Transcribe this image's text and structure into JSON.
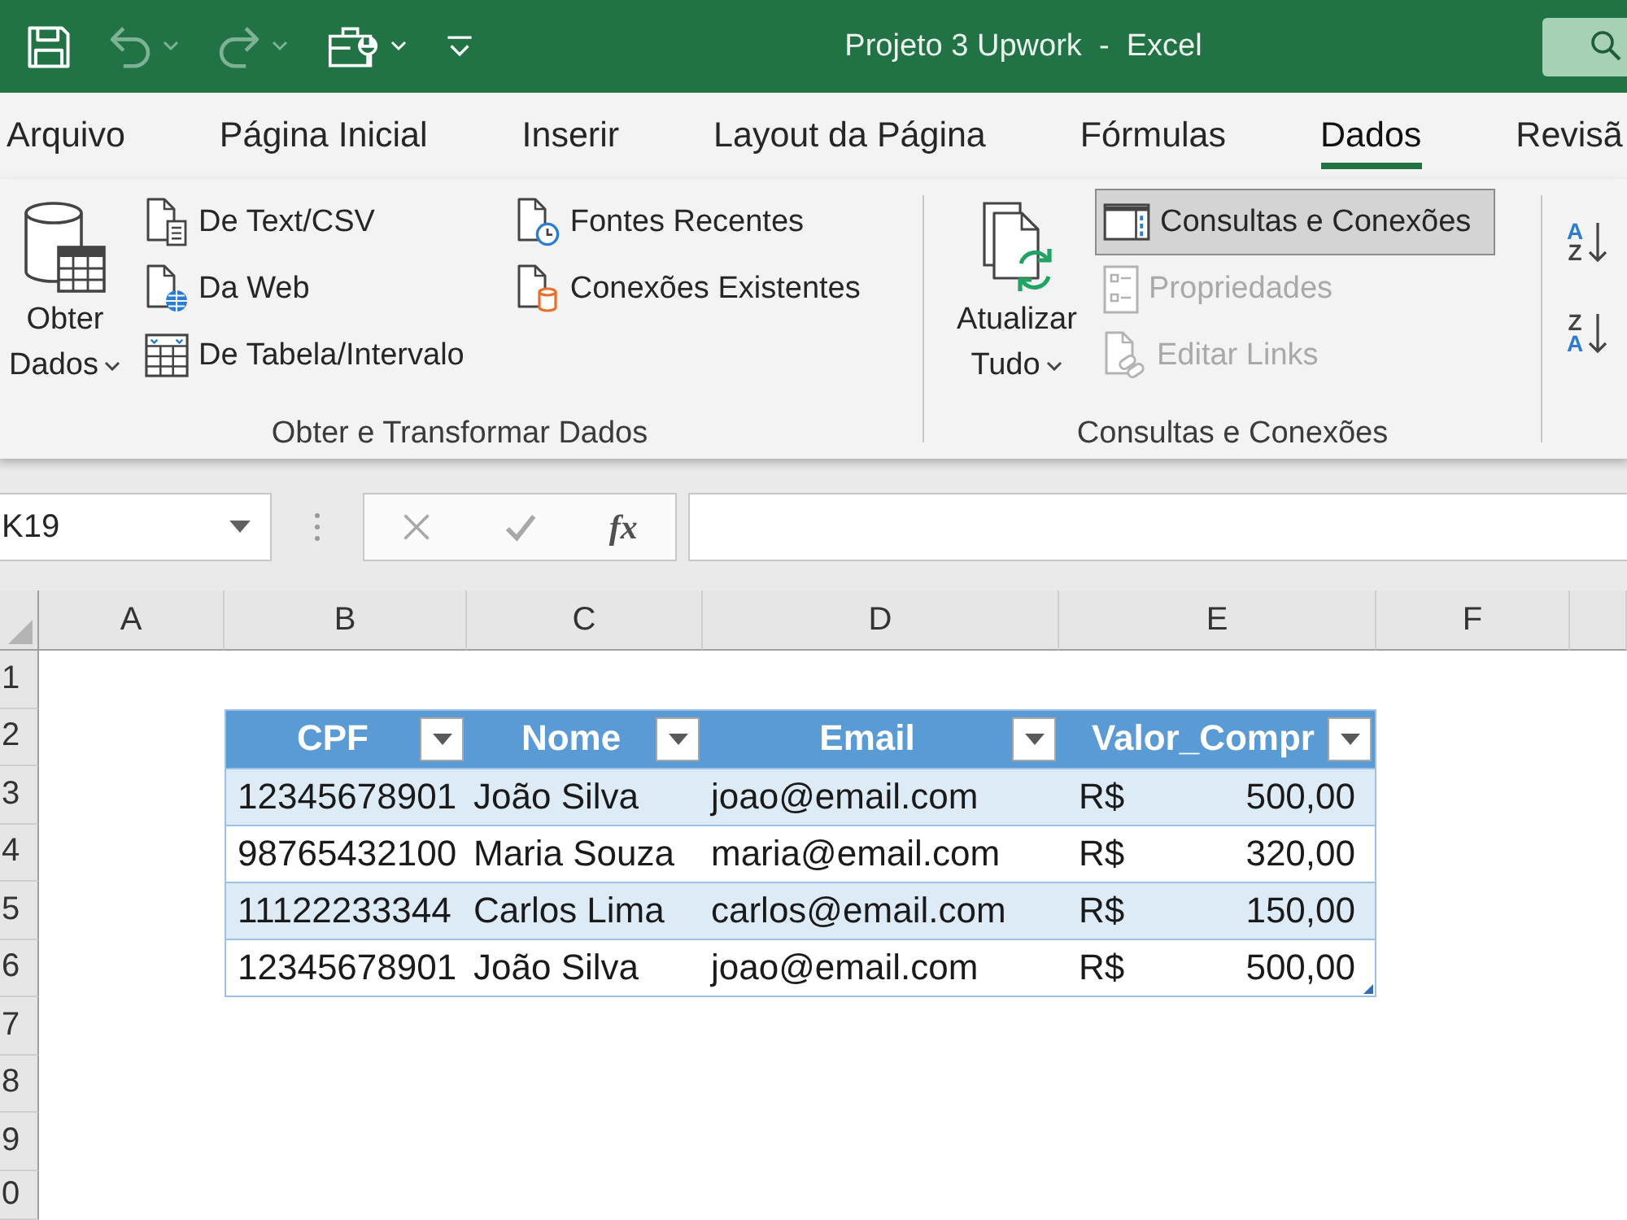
{
  "window": {
    "title": "Projeto 3 Upwork  -  Excel"
  },
  "quick_access": [
    {
      "kind": "save",
      "disabled": false,
      "menu": false
    },
    {
      "kind": "undo",
      "disabled": true,
      "menu": true
    },
    {
      "kind": "redo",
      "disabled": true,
      "menu": true
    },
    {
      "kind": "touch_mode",
      "disabled": false,
      "menu": true
    },
    {
      "kind": "customize",
      "disabled": false,
      "menu": false
    }
  ],
  "ribbon_tabs": [
    {
      "label": "Arquivo",
      "selected": false
    },
    {
      "label": "Página Inicial",
      "selected": false
    },
    {
      "label": "Inserir",
      "selected": false
    },
    {
      "label": "Layout da Página",
      "selected": false
    },
    {
      "label": "Fórmulas",
      "selected": false
    },
    {
      "label": "Dados",
      "selected": true
    },
    {
      "label": "Revisã",
      "selected": false
    }
  ],
  "ribbon_groups": [
    {
      "label": "Obter e Transformar Dados",
      "large_buttons": [
        {
          "label": "Obter Dados",
          "kind": "database",
          "menu": true
        }
      ],
      "columns": [
        [
          {
            "label": "De Text/CSV",
            "kind": "text_file",
            "pressed": false,
            "disabled": false
          },
          {
            "label": "Da Web",
            "kind": "web",
            "pressed": false,
            "disabled": false
          },
          {
            "label": "De Tabela/Intervalo",
            "kind": "table",
            "pressed": false,
            "disabled": false
          }
        ],
        [
          {
            "label": "Fontes Recentes",
            "kind": "recent",
            "pressed": false,
            "disabled": false
          },
          {
            "label": "Conexões Existentes",
            "kind": "connections",
            "pressed": false,
            "disabled": false
          }
        ]
      ]
    },
    {
      "label": "Consultas e Conexões",
      "large_buttons": [
        {
          "label": "Atualizar Tudo",
          "kind": "refresh",
          "menu": true
        }
      ],
      "columns": [
        [
          {
            "label": "Consultas e Conexões",
            "kind": "queries_pane",
            "pressed": true,
            "disabled": false
          },
          {
            "label": "Propriedades",
            "kind": "properties",
            "pressed": false,
            "disabled": true
          },
          {
            "label": "Editar Links",
            "kind": "edit_links",
            "pressed": false,
            "disabled": true
          }
        ]
      ]
    },
    {
      "sort_buttons": [
        {
          "kind": "ascending",
          "letters": [
            "A",
            "Z"
          ]
        },
        {
          "kind": "descending",
          "letters": [
            "Z",
            "A"
          ]
        }
      ]
    }
  ],
  "formula_bar": {
    "name_box": "K19",
    "buttons": [
      {
        "kind": "cancel",
        "disabled": true
      },
      {
        "kind": "enter",
        "disabled": true
      },
      {
        "kind": "insert_function",
        "label": "fx",
        "disabled": false
      }
    ]
  },
  "sheet": {
    "columns": [
      "A",
      "B",
      "C",
      "D",
      "E",
      "F"
    ],
    "rows": [
      "1",
      "2",
      "3",
      "4",
      "5",
      "6",
      "7",
      "8",
      "9",
      "0"
    ]
  },
  "table": {
    "columns": [
      {
        "label": "CPF",
        "filter": true
      },
      {
        "label": "Nome",
        "filter": true
      },
      {
        "label": "Email",
        "filter": true
      },
      {
        "label": "Valor_Compr",
        "filter": true
      }
    ],
    "rows": [
      {
        "cpf": "12345678901",
        "nome": "João Silva",
        "email": "joao@email.com",
        "valor": {
          "currency": "R$",
          "amount": "500,00"
        }
      },
      {
        "cpf": "98765432100",
        "nome": "Maria Souza",
        "email": "maria@email.com",
        "valor": {
          "currency": "R$",
          "amount": "320,00"
        }
      },
      {
        "cpf": "11122233344",
        "nome": "Carlos Lima",
        "email": "carlos@email.com",
        "valor": {
          "currency": "R$",
          "amount": "150,00"
        }
      },
      {
        "cpf": "12345678901",
        "nome": "João Silva",
        "email": "joao@email.com",
        "valor": {
          "currency": "R$",
          "amount": "500,00"
        }
      }
    ]
  }
}
